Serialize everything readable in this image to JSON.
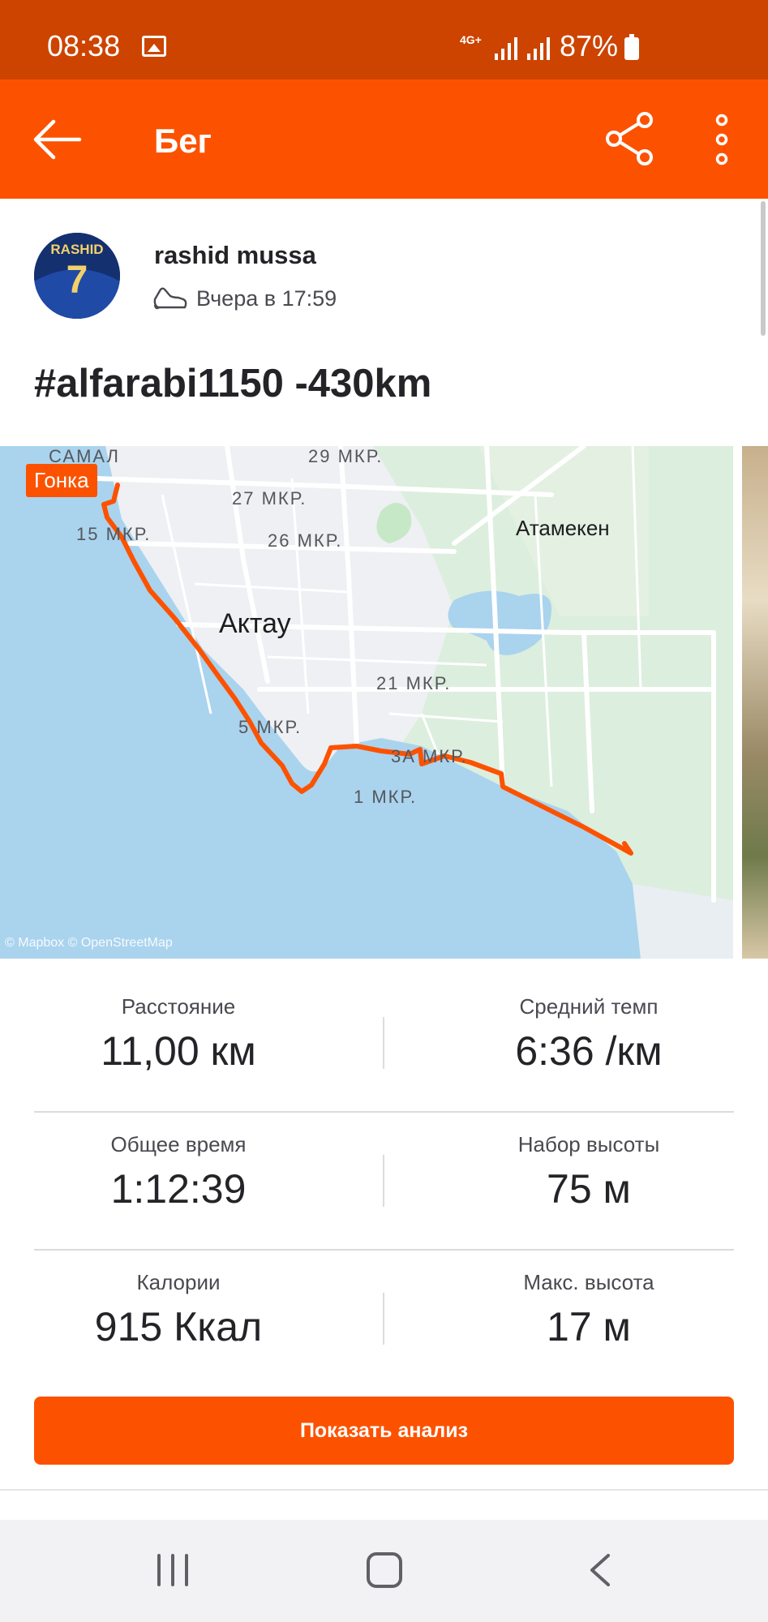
{
  "status_bar": {
    "time": "08:38",
    "network": "4G+",
    "battery": "87%"
  },
  "app_bar": {
    "title": "Бег"
  },
  "activity": {
    "athlete_name": "rashid mussa",
    "avatar_text": "RASHID",
    "avatar_number": "7",
    "time": "Вчера в 17:59",
    "title": "#alfarabi1150 -430km"
  },
  "map": {
    "race_badge": "Гонка",
    "attribution": "© Mapbox © OpenStreetMap",
    "labels": {
      "samal": "САМАЛ",
      "mkr29": "29 МКР.",
      "mkr27": "27 МКР.",
      "mkr15": "15 МКР.",
      "mkr26": "26 МКР.",
      "aktau": "Актау",
      "atameken": "Атамекен",
      "mkr21": "21 МКР.",
      "mkr5": "5 МКР.",
      "mkr3a": "3А МКР.",
      "mkr1": "1 МКР."
    }
  },
  "stats": [
    {
      "label": "Расстояние",
      "value": "11,00 км"
    },
    {
      "label": "Средний темп",
      "value": "6:36 /км"
    },
    {
      "label": "Общее время",
      "value": "1:12:39"
    },
    {
      "label": "Набор высоты",
      "value": "75 м"
    },
    {
      "label": "Калории",
      "value": "915 Ккал"
    },
    {
      "label": "Макс. высота",
      "value": "17 м"
    }
  ],
  "analysis_button": "Показать анализ",
  "colors": {
    "brand": "#fc5200",
    "status_bar": "#cc4400",
    "water": "#aad3ee",
    "route": "#fc5200"
  },
  "icons": [
    "back-arrow-icon",
    "share-icon",
    "more-vertical-icon",
    "shoe-icon",
    "recent-apps-icon",
    "home-icon",
    "nav-back-icon"
  ]
}
